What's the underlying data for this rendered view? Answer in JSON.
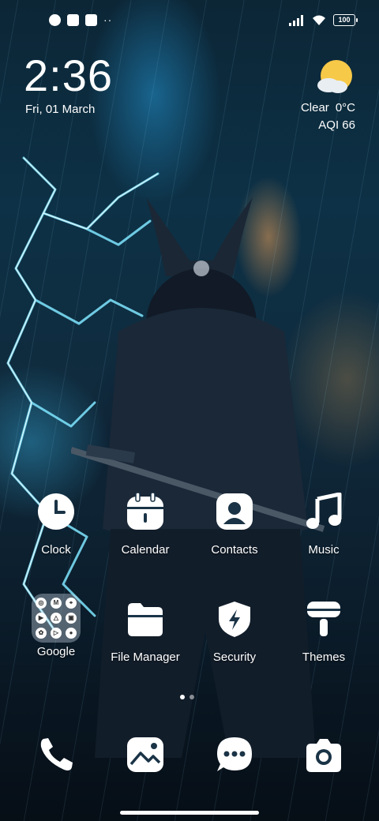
{
  "status_bar": {
    "battery": "100",
    "overflow": "··"
  },
  "clock_widget": {
    "time": "2:36",
    "date": "Fri, 01 March"
  },
  "weather_widget": {
    "condition": "Clear",
    "temperature": "0°C",
    "aqi": "AQI 66",
    "icon": "sun-cloud-icon"
  },
  "apps": {
    "clock": "Clock",
    "calendar": "Calendar",
    "contacts": "Contacts",
    "music": "Music",
    "google": "Google",
    "file_manager": "File Manager",
    "security": "Security",
    "themes": "Themes"
  },
  "dock": [
    "phone-icon",
    "gallery-icon",
    "messages-icon",
    "camera-icon"
  ],
  "colors": {
    "icon": "#ffffff",
    "sun": "#f7c948"
  }
}
